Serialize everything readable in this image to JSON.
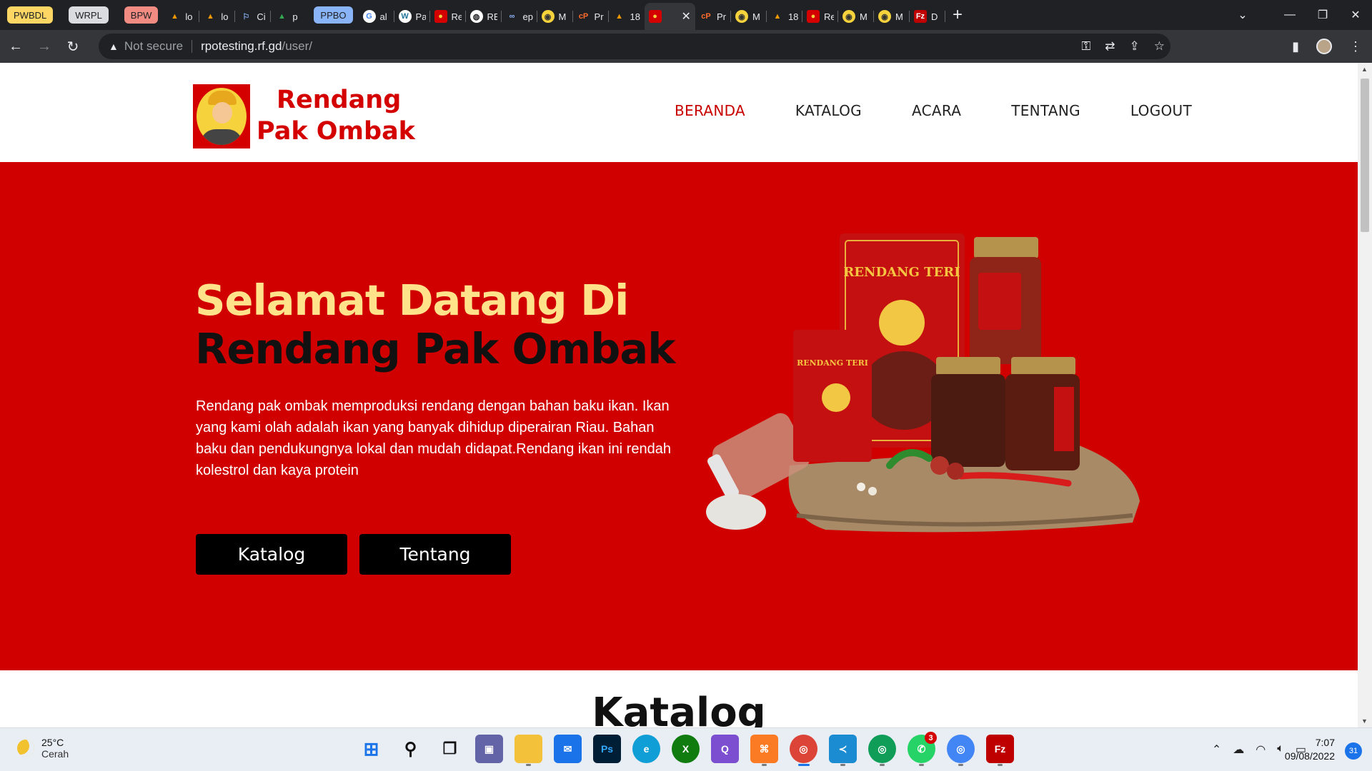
{
  "browser": {
    "tab_groups": [
      {
        "label": "PWBDL",
        "color": "#fdd663"
      },
      {
        "label": "WRPL",
        "color": "#dadce0"
      },
      {
        "label": "BPW",
        "color": "#f28b82"
      },
      {
        "label": "PPBO",
        "color": "#8ab4f8"
      }
    ],
    "tabs": [
      {
        "title": "lo",
        "icon": "triangle-logo-icon"
      },
      {
        "title": "lo",
        "icon": "triangle-logo-icon"
      },
      {
        "title": "Ci",
        "icon": "flag-icon"
      },
      {
        "title": "p",
        "icon": "google-drive-icon"
      },
      {
        "title": "al",
        "icon": "google-icon"
      },
      {
        "title": "Pa",
        "icon": "wordpress-icon"
      },
      {
        "title": "Re",
        "icon": "rendang-favicon-icon"
      },
      {
        "title": "RE",
        "icon": "globe-icon"
      },
      {
        "title": "ep",
        "icon": "infinity-icon"
      },
      {
        "title": "M",
        "icon": "moodle-icon"
      },
      {
        "title": "Pr",
        "icon": "cpanel-icon"
      },
      {
        "title": "18",
        "icon": "triangle-logo-icon"
      },
      {
        "title": "",
        "icon": "rendang-favicon-icon",
        "active": true
      },
      {
        "title": "Pr",
        "icon": "cpanel-icon"
      },
      {
        "title": "M",
        "icon": "moodle-icon"
      },
      {
        "title": "18",
        "icon": "triangle-logo-icon"
      },
      {
        "title": "Re",
        "icon": "rendang-favicon-icon"
      },
      {
        "title": "M",
        "icon": "moodle-icon"
      },
      {
        "title": "M",
        "icon": "moodle-icon"
      },
      {
        "title": "D",
        "icon": "filezilla-icon"
      }
    ],
    "security_label": "Not secure",
    "url_host": "rpotesting.rf.gd",
    "url_path": "/user/"
  },
  "site": {
    "brand_line1": "Rendang",
    "brand_line2": "Pak Ombak",
    "logo_text": "Pak Ombak",
    "nav": [
      {
        "label": "BERANDA",
        "active": true
      },
      {
        "label": "KATALOG"
      },
      {
        "label": "ACARA"
      },
      {
        "label": "TENTANG"
      },
      {
        "label": "LOGOUT"
      }
    ],
    "colors": {
      "brand_red": "#d10000",
      "headline_yellow": "#ffe28a"
    }
  },
  "hero": {
    "title_line1": "Selamat Datang Di",
    "title_line2": "Rendang Pak Ombak",
    "description": "Rendang pak ombak memproduksi rendang dengan bahan baku ikan. Ikan yang kami olah adalah ikan yang banyak dihidup diperairan Riau. Bahan baku dan pendukungnya lokal dan mudah didapat.Rendang ikan ini rendah kolestrol dan kaya protein",
    "button_katalog": "Katalog",
    "button_tentang": "Tentang",
    "product_labels": {
      "pouch": "RENDANG TERI",
      "small_pouch": "RENDANG TERI"
    }
  },
  "section": {
    "title": "Katalog"
  },
  "taskbar": {
    "weather_temp": "25°C",
    "weather_desc": "Cerah",
    "time": "7:07",
    "date": "09/08/2022",
    "notification_count": "31",
    "whatsapp_badge": "3"
  }
}
